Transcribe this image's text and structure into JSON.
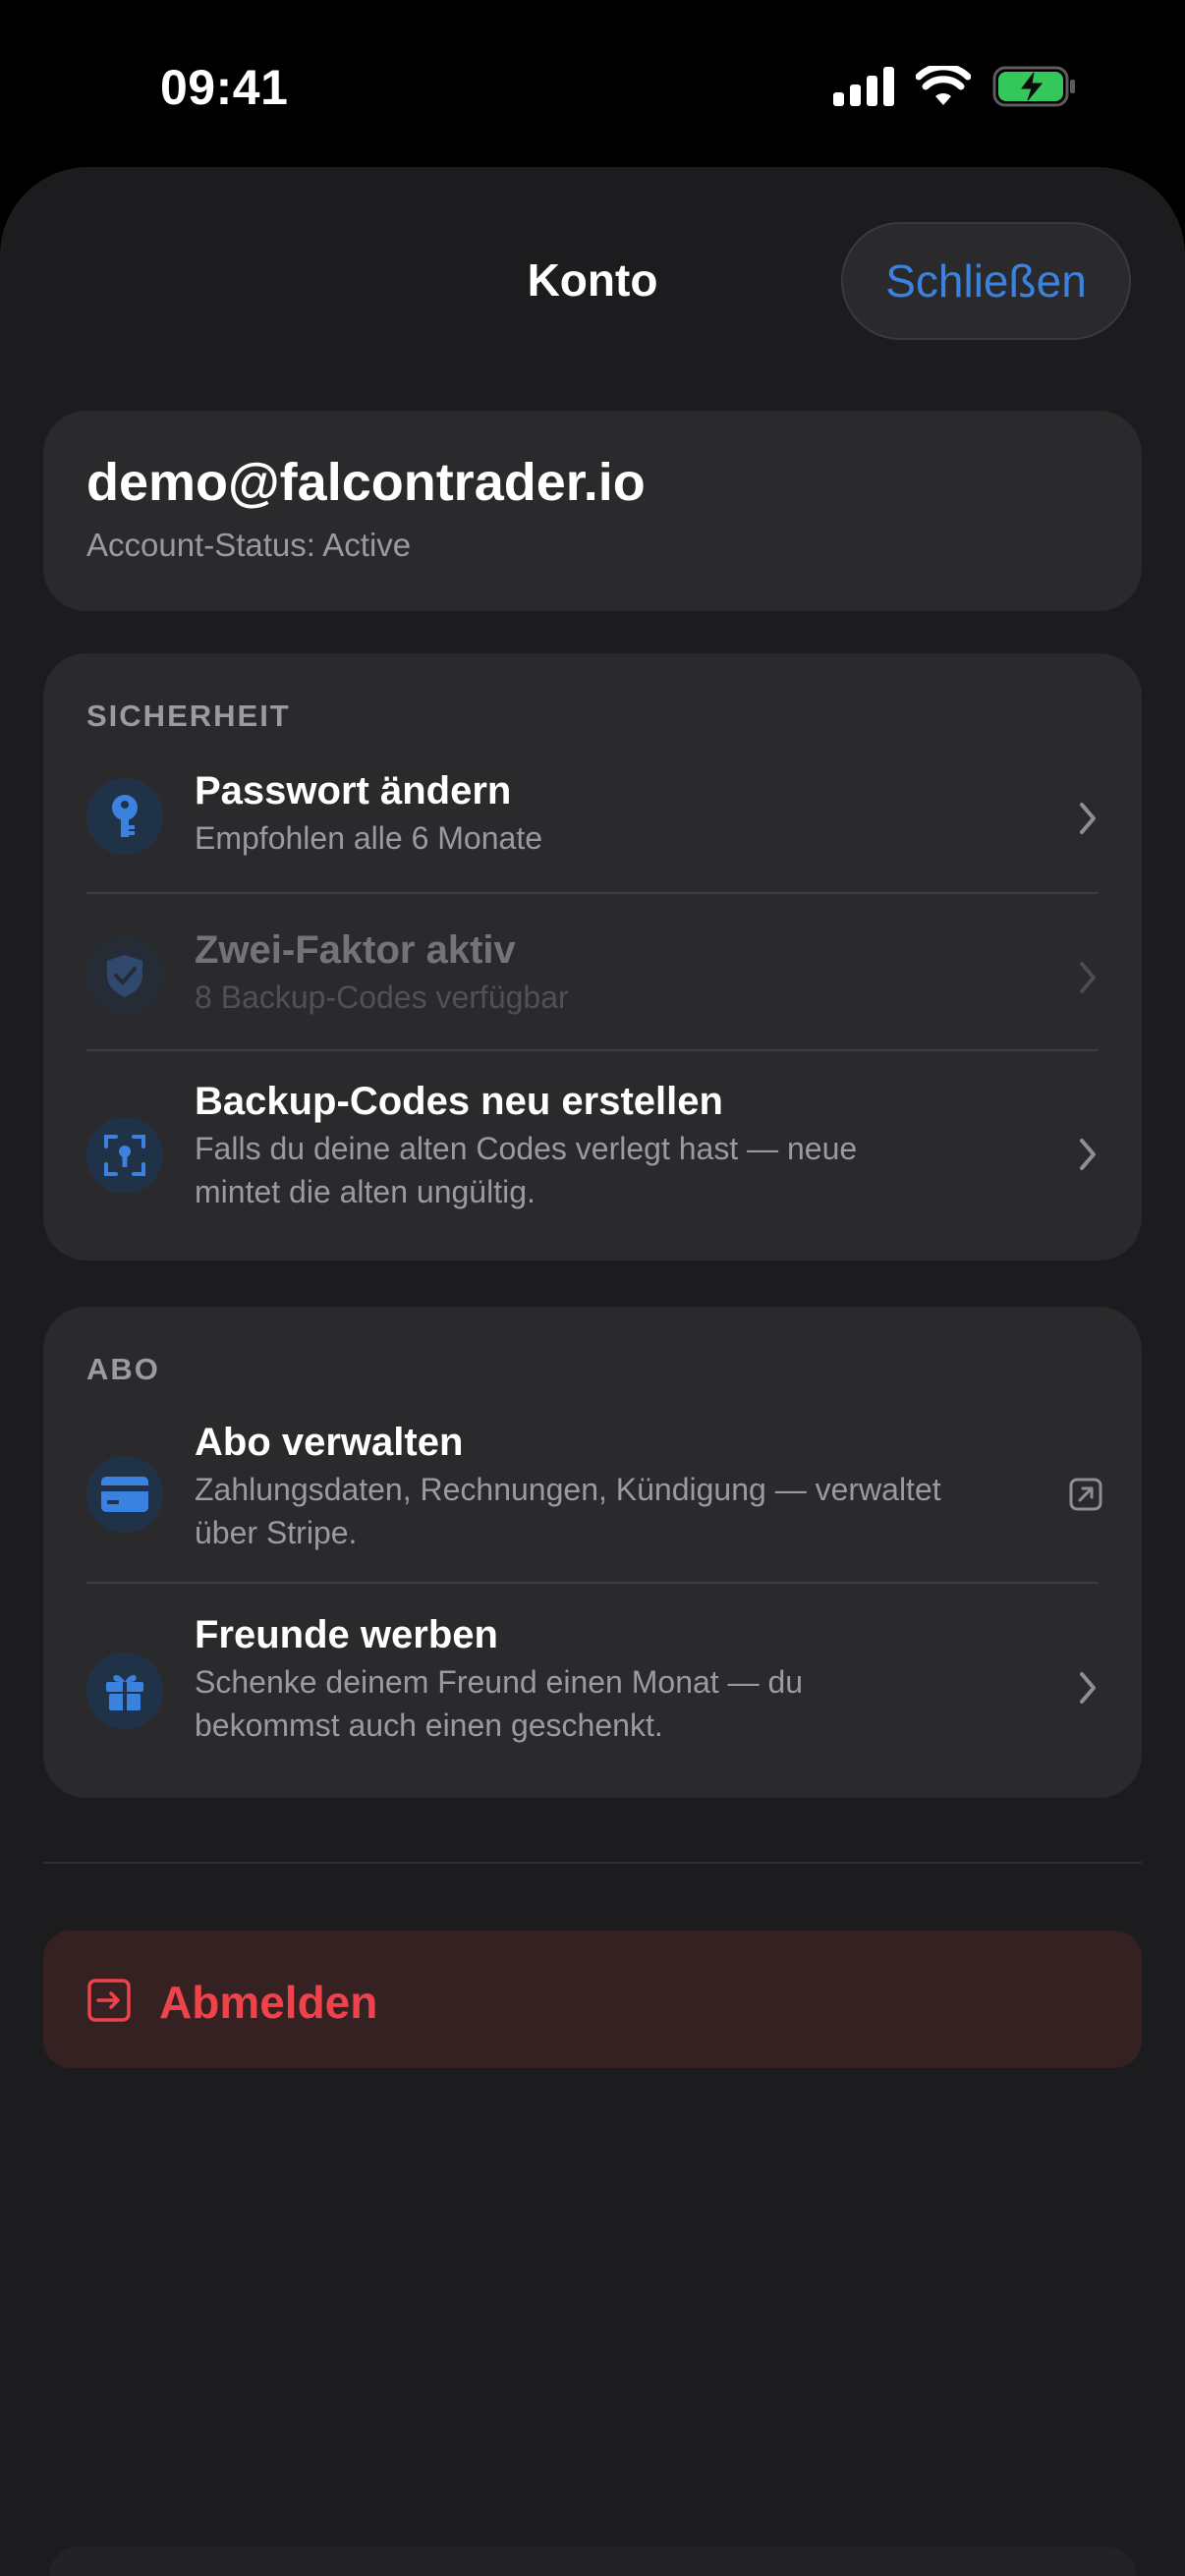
{
  "status_bar": {
    "time": "09:41"
  },
  "header": {
    "title": "Konto",
    "close_label": "Schließen"
  },
  "account": {
    "email": "demo@falcontrader.io",
    "status": "Account-Status: Active"
  },
  "security": {
    "section_label": "SICHERHEIT",
    "items": [
      {
        "title": "Passwort ändern",
        "subtitle": "Empfohlen alle 6 Monate",
        "icon": "key-icon"
      },
      {
        "title": "Zwei-Faktor aktiv",
        "subtitle": "8 Backup-Codes verfügbar",
        "icon": "shield-check-icon"
      },
      {
        "title": "Backup-Codes neu erstellen",
        "subtitle": "Falls du deine alten Codes verlegt hast — neue mintet die alten ungültig.",
        "icon": "scan-key-icon"
      }
    ]
  },
  "subscription": {
    "section_label": "ABO",
    "items": [
      {
        "title": "Abo verwalten",
        "subtitle": "Zahlungsdaten, Rechnungen, Kündigung — verwaltet über Stripe.",
        "icon": "credit-card-icon"
      },
      {
        "title": "Freunde werben",
        "subtitle": "Schenke deinem Freund einen Monat — du bekommst auch einen geschenkt.",
        "icon": "gift-icon"
      }
    ]
  },
  "logout": {
    "label": "Abmelden",
    "color": "#f0424a"
  },
  "colors": {
    "accent": "#3b82e0",
    "background": "#1c1c1e",
    "card": "#2a2a2d",
    "danger": "#f0424a"
  }
}
